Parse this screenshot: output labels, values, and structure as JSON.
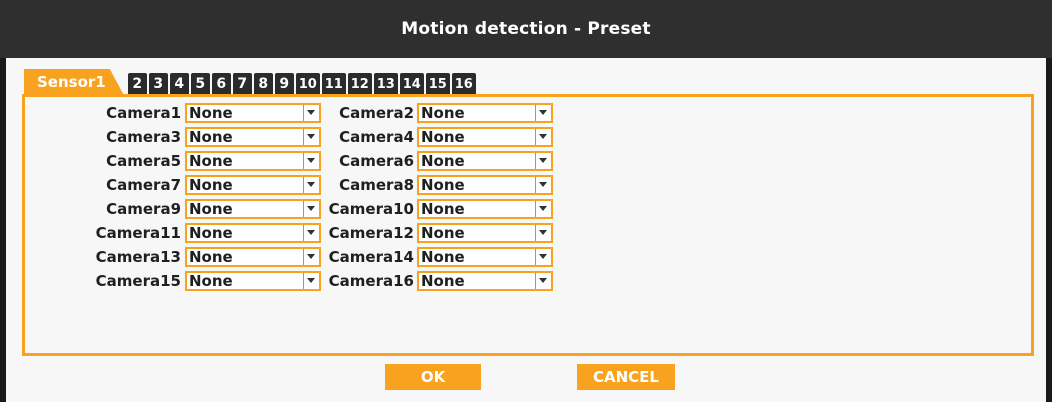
{
  "window": {
    "title": "Motion detection - Preset"
  },
  "tabs": {
    "active": "Sensor1",
    "numbers": [
      "2",
      "3",
      "4",
      "5",
      "6",
      "7",
      "8",
      "9",
      "10",
      "11",
      "12",
      "13",
      "14",
      "15",
      "16"
    ]
  },
  "cameras": [
    {
      "label": "Camera1",
      "value": "None"
    },
    {
      "label": "Camera2",
      "value": "None"
    },
    {
      "label": "Camera3",
      "value": "None"
    },
    {
      "label": "Camera4",
      "value": "None"
    },
    {
      "label": "Camera5",
      "value": "None"
    },
    {
      "label": "Camera6",
      "value": "None"
    },
    {
      "label": "Camera7",
      "value": "None"
    },
    {
      "label": "Camera8",
      "value": "None"
    },
    {
      "label": "Camera9",
      "value": "None"
    },
    {
      "label": "Camera10",
      "value": "None"
    },
    {
      "label": "Camera11",
      "value": "None"
    },
    {
      "label": "Camera12",
      "value": "None"
    },
    {
      "label": "Camera13",
      "value": "None"
    },
    {
      "label": "Camera14",
      "value": "None"
    },
    {
      "label": "Camera15",
      "value": "None"
    },
    {
      "label": "Camera16",
      "value": "None"
    }
  ],
  "buttons": {
    "ok": "OK",
    "cancel": "CANCEL"
  },
  "colors": {
    "accent": "#f8a21f",
    "titlebar": "#2f2f2f",
    "tab_inactive": "#2b2b2b"
  }
}
